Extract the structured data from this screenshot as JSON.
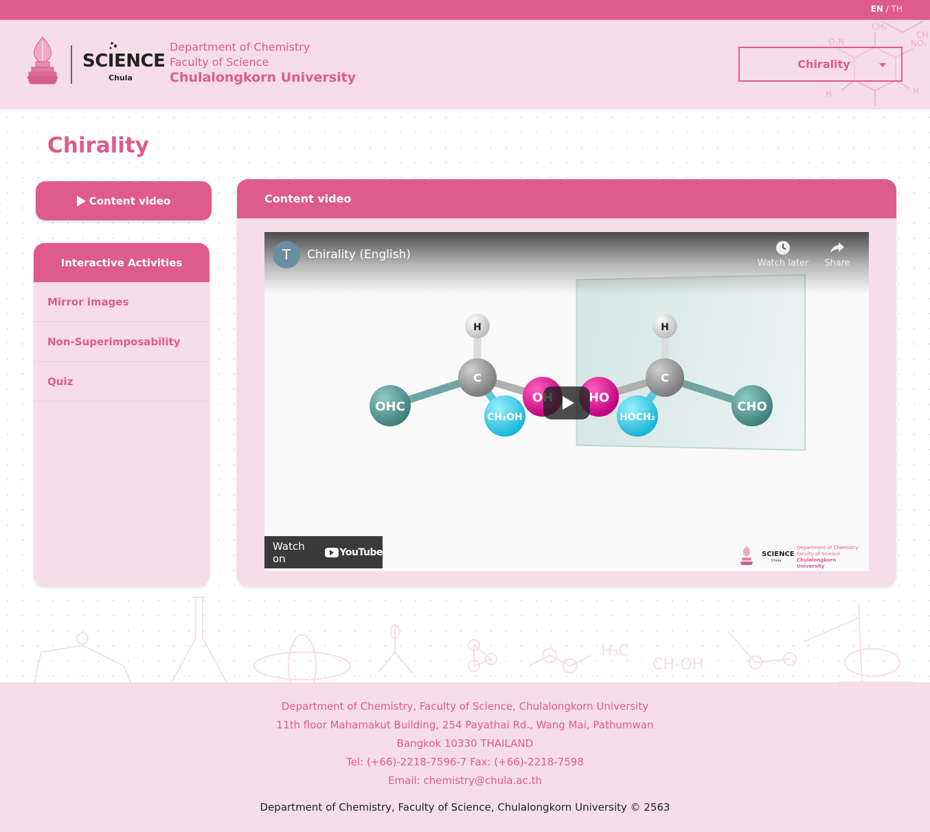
{
  "lang": {
    "en": "EN",
    "sep": " / ",
    "th": "TH"
  },
  "header": {
    "logo_text": "SCIENCE",
    "logo_sub": "Chula",
    "dept_line1": "Department of Chemistry",
    "dept_line2": "Faculty of Science",
    "dept_line3": "Chulalongkorn University",
    "topic_select": "Chirality"
  },
  "page": {
    "title": "Chirality"
  },
  "sidebar": {
    "content_video_button": "Content video",
    "activities_title": "Interactive Activities",
    "items": [
      {
        "label": "Mirror images"
      },
      {
        "label": "Non-Superimposability"
      },
      {
        "label": "Quiz"
      }
    ]
  },
  "video_panel": {
    "title": "Content video",
    "player": {
      "channel_initial": "T",
      "video_title": "Chirality (English)",
      "watch_later": "Watch later",
      "share": "Share",
      "watch_on": "Watch on",
      "youtube": "YouTube",
      "atoms": {
        "h_left": "H",
        "c_left": "C",
        "ohc": "OHC",
        "ch2oh": "CH₂OH",
        "oh": "OH",
        "ho": "HO",
        "h_right": "H",
        "c_right": "C",
        "hoch2": "HOCH₂",
        "cho": "CHO"
      },
      "watermark": {
        "sci": "SCIENCE",
        "sub": "Chula",
        "l1": "Department of Chemistry",
        "l2": "Faculty of Science",
        "l3": "Chulalongkorn University"
      }
    }
  },
  "footer": {
    "line1": "Department of Chemistry, Faculty of Science, Chulalongkorn University",
    "line2": "11th floor Mahamakut Building, 254 Payathai Rd., Wang Mai, Pathumwan",
    "line3": "Bangkok 10330 THAILAND",
    "line4": "Tel: (+66)-2218-7596-7 Fax: (+66)-2218-7598",
    "email_label": "Email: ",
    "email": "chemistry@chula.ac.th",
    "copyright": "Department of Chemistry, Faculty of Science, Chulalongkorn University © 2563"
  },
  "colors": {
    "brand_pink": "#df5b8c",
    "light_pink": "#f7dde9"
  }
}
